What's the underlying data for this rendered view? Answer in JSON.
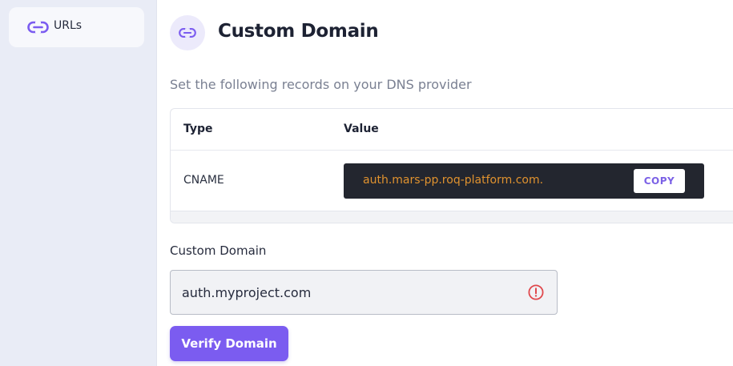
{
  "sidebar": {
    "items": [
      {
        "label": "URLs",
        "icon": "link-icon"
      }
    ]
  },
  "header": {
    "title": "Custom Domain",
    "icon": "link-icon"
  },
  "instructions": "Set the following records on your DNS provider",
  "dns_table": {
    "columns": [
      "Type",
      "Value"
    ],
    "rows": [
      {
        "type": "CNAME",
        "value": "auth.mars-pp.roq-platform.com.",
        "copy_label": "COPY"
      }
    ]
  },
  "custom_domain": {
    "label": "Custom Domain",
    "value": "auth.myproject.com",
    "status_icon": "error-icon"
  },
  "verify_button": {
    "label": "Verify Domain"
  },
  "colors": {
    "accent": "#7b5cf0",
    "error": "#e0484c",
    "value_text": "#e0922f"
  }
}
